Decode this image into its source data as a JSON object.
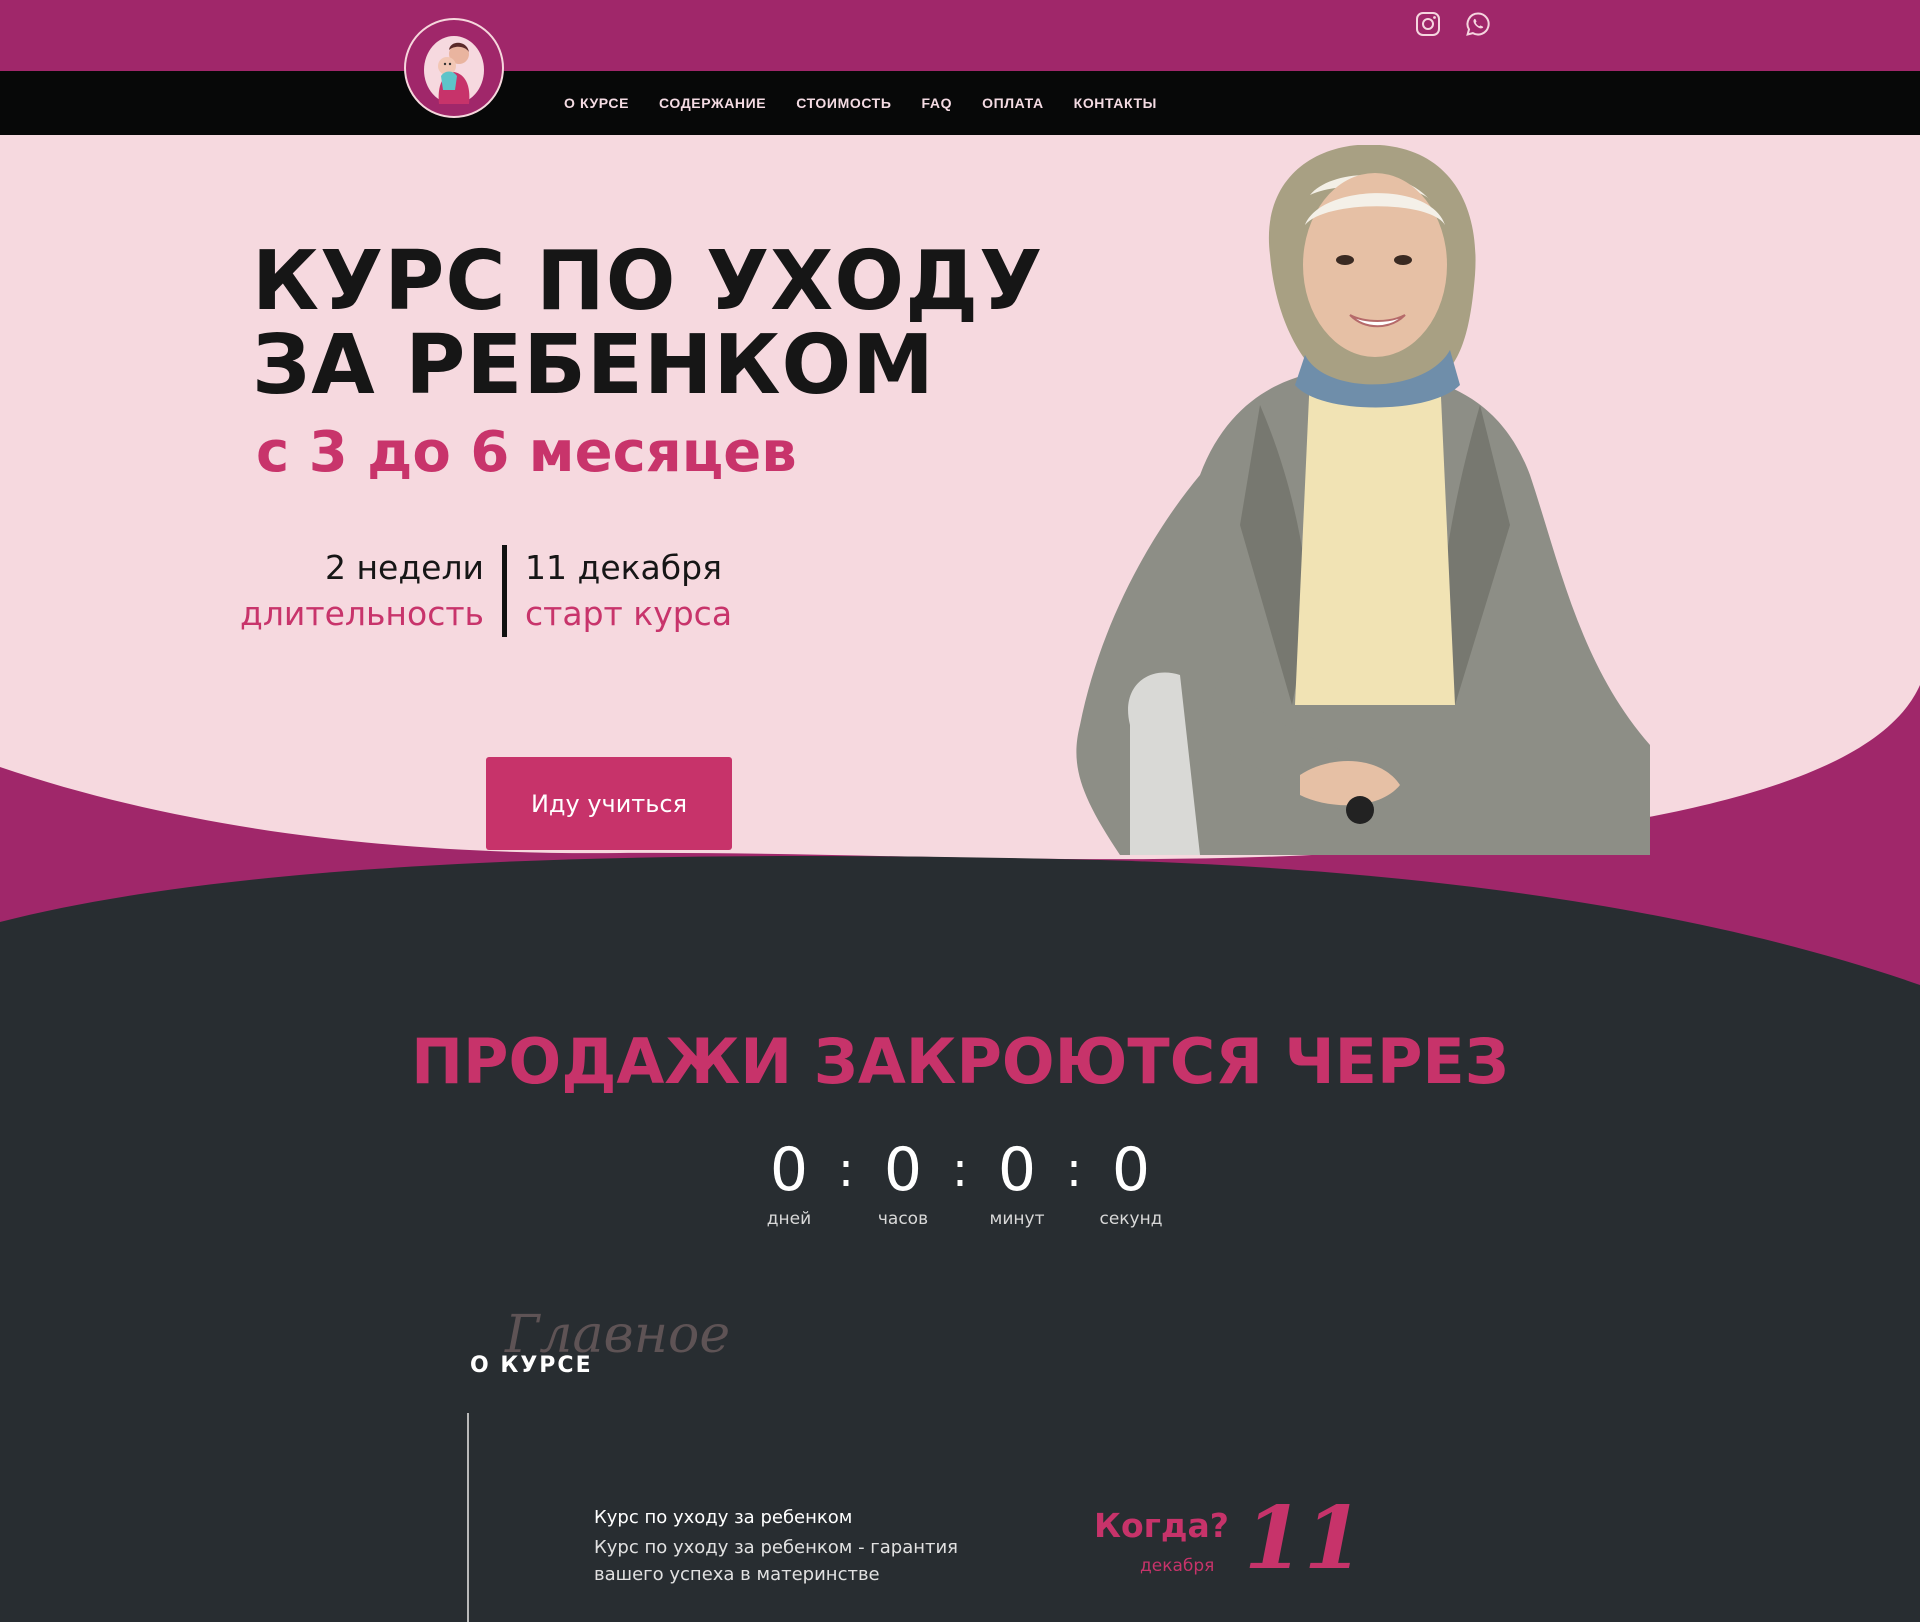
{
  "nav": {
    "items": [
      {
        "label": "О КУРСЕ"
      },
      {
        "label": "СОДЕРЖАНИЕ"
      },
      {
        "label": "СТОИМОСТЬ"
      },
      {
        "label": "FAQ"
      },
      {
        "label": "ОПЛАТА"
      },
      {
        "label": "КОНТАКТЫ"
      }
    ]
  },
  "social": {
    "icons": [
      "instagram-icon",
      "whatsapp-icon"
    ]
  },
  "hero": {
    "title_line1": "КУРС ПО УХОДУ",
    "title_line2": "ЗА РЕБЕНКОМ",
    "subtitle": "с 3 до 6 месяцев",
    "duration_value": "2 недели",
    "duration_label": "длительность",
    "start_value": "11 декабря",
    "start_label": "старт курса",
    "cta_label": "Иду учиться"
  },
  "countdown": {
    "title": "ПРОДАЖИ ЗАКРОЮТСЯ ЧЕРЕЗ",
    "days": "0",
    "hours": "0",
    "minutes": "0",
    "seconds": "0",
    "days_label": "дней",
    "hours_label": "часов",
    "minutes_label": "минут",
    "seconds_label": "секунд",
    "separator": ":"
  },
  "about": {
    "script_word": "Главное",
    "label": "О КУРСЕ",
    "title": "Курс по уходу за ребенком",
    "text": "Курс по уходу за ребенком - гарантия вашего успеха в материнстве",
    "when_question": "Когда?",
    "when_day": "11",
    "when_month": "декабря"
  },
  "colors": {
    "brand_magenta": "#a0276a",
    "accent_pink": "#c7336a",
    "hero_bg": "#f6d9df",
    "dark_bg": "#282d31",
    "nav_bg": "#070808"
  }
}
